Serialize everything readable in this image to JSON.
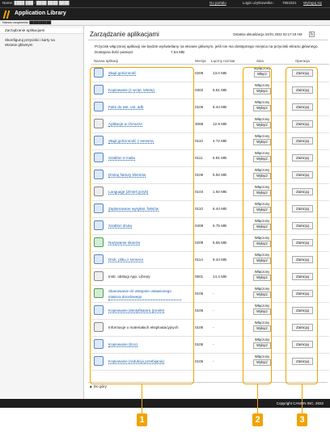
{
  "header": {
    "device_info": "Name: ████ ███ / ████ ████ ████",
    "portal_link": "Do portalu",
    "login_label": "Login użytkownika :",
    "login_value": "7654321",
    "logout": "Wyloguj się",
    "app_title": "Application Library",
    "device_name_label": "Nazwa urządzenia: ██████████"
  },
  "sidebar": {
    "items": [
      {
        "label": "Zarządzanie aplikacjami"
      },
      {
        "label": "Skonfiguruj przyciski i karty na ekranie głównym"
      }
    ]
  },
  "main": {
    "title": "Zarządzanie aplikacjami",
    "updated": "Ostatnia aktualizacja 24/01 2022 02:17:19 AM",
    "refresh_icon": "refresh-icon",
    "info": "Przycisk włączonej aplikacji nie będzie wyświetlany na ekranie głównym, jeśli nie ma dostępnego miejsca na przyciski ekranu głównego.",
    "memory_label": "Dostępna ilość pamięci:",
    "memory_value": "7.54 MB",
    "columns": {
      "name": "Nazwa aplikacji",
      "version": "Wersja",
      "size": "Łączny rozmiar",
      "state": "Stan",
      "operation": "Operacja"
    },
    "back_to_top": "Do góry",
    "rows": [
      {
        "icon": "print-icon",
        "name": "Słajd gościnność",
        "link": true,
        "version": "0208",
        "size": "13.0 MB",
        "state": "Wyłączony",
        "toggle": "Włącz",
        "op": "Zainicjuj"
      },
      {
        "icon": "copy-icon",
        "name": "Kopiowanie (z wcięt. tekstu)",
        "link": true,
        "version": "0302",
        "size": "6.51 MB",
        "state": "Włączony",
        "toggle": "Wyłącz",
        "op": "Zainicjuj"
      },
      {
        "icon": "fax-icon",
        "name": "Faks do wst. ust. adb",
        "link": true,
        "version": "0106",
        "size": "6.44 MB",
        "state": "Włączony",
        "toggle": "Wyłącz",
        "op": "Zainicjuj"
      },
      {
        "icon": "cloud-icon",
        "name": "Aplikacje w chmurze",
        "link": true,
        "version": "3068",
        "size": "12.9 MB",
        "state": "Włączony",
        "toggle": "Wyłącz",
        "op": "Zainicjuj"
      },
      {
        "icon": "print-icon",
        "name": "Słajd gościnność z serwera",
        "link": true,
        "version": "0110",
        "size": "4.72 MB",
        "state": "Włączony",
        "toggle": "Wyłącz",
        "op": "Zainicjuj"
      },
      {
        "icon": "scan-mail-icon",
        "name": "Szablon e-maila",
        "link": true,
        "version": "0111",
        "size": "6.81 MB",
        "state": "Włączony",
        "toggle": "Wyłącz",
        "op": "Zainicjuj"
      },
      {
        "icon": "print-icon",
        "name": "Drukuj faktury klientów",
        "link": true,
        "version": "0106",
        "size": "5.92 MB",
        "state": "Włączony",
        "toggle": "Wyłącz",
        "op": "Zainicjuj"
      },
      {
        "icon": "language-icon",
        "name": "Language (Zmień język)",
        "link": true,
        "version": "0104",
        "size": "1.92 MB",
        "state": "Włączony",
        "toggle": "Wyłącz",
        "op": "Zainicjuj"
      },
      {
        "icon": "fax-icon",
        "name": "Zaplanowane wysyłan. faksów",
        "link": true,
        "version": "0110",
        "size": "6.44 MB",
        "state": "Włączony",
        "toggle": "Wyłącz",
        "op": "Zainicjuj"
      },
      {
        "icon": "print-icon",
        "name": "Szablon druku",
        "link": true,
        "version": "0408",
        "size": "6.75 MB",
        "state": "Włączony",
        "toggle": "Wyłącz",
        "op": "Zainicjuj"
      },
      {
        "icon": "scan-icon",
        "name": "Nazywanie skanów",
        "link": true,
        "version": "0209",
        "size": "6.65 MB",
        "state": "Włączony",
        "toggle": "Wyłącz",
        "op": "Zainicjuj"
      },
      {
        "icon": "print-icon",
        "name": "Druk. pliku z serwera",
        "link": true,
        "version": "0114",
        "size": "9.44 MB",
        "state": "Włączony",
        "toggle": "Wyłącz",
        "op": "Zainicjuj"
      },
      {
        "icon": "library-icon",
        "name": "Instr. obsługi App. Library",
        "link": false,
        "version": "0601",
        "size": "14.4 MB",
        "state": "Włączony",
        "toggle": "Wyłącz",
        "op": "Zainicjuj"
      },
      {
        "icon": "scan-icon",
        "name": "Skanowanie do wstępnie ustawionego miejsca docelowego",
        "link": true,
        "two": true,
        "version": "0106",
        "size": "-",
        "state": "Włączony",
        "toggle": "Wyłącz",
        "op": "Zainicjuj"
      },
      {
        "icon": "copy-icon",
        "name": "Kopiowanie identyfikatora (proste)",
        "link": true,
        "version": "0106",
        "size": "-",
        "state": "Włączony",
        "toggle": "Wyłącz",
        "op": "Zainicjuj"
      },
      {
        "icon": "info-icon",
        "name": "Informacje o materiałach eksploatacyjnych",
        "link": false,
        "version": "0106",
        "size": "-",
        "state": "Włączony",
        "toggle": "Wyłącz",
        "op": "Zainicjuj"
      },
      {
        "icon": "copy-icon",
        "name": "Kopiowanie (Eco)",
        "link": true,
        "version": "0106",
        "size": "-",
        "state": "Włączony",
        "toggle": "Wyłącz",
        "op": "Zainicjuj"
      },
      {
        "icon": "copy-icon",
        "name": "Kopiowanie (redukcja przebijania)",
        "link": true,
        "version": "0106",
        "size": "-",
        "state": "Włączony",
        "toggle": "Wyłącz",
        "op": "Zainicjuj"
      }
    ]
  },
  "footer": {
    "copyright": "Copyright CANON INC. 2022"
  },
  "callouts": [
    "1",
    "2",
    "3"
  ],
  "colors": {
    "accent": "#f0a300",
    "link": "#1a5fa8",
    "bar": "#1e1e1e"
  }
}
